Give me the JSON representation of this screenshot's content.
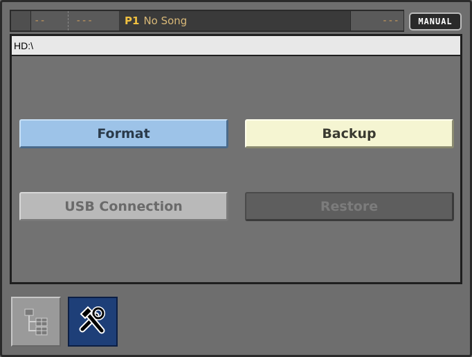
{
  "statusbar": {
    "field1": "--",
    "field2": "---",
    "program": "P1",
    "song": "No Song",
    "field4": "---",
    "mode": "MANUAL"
  },
  "path": "HD:\\",
  "buttons": {
    "format": "Format",
    "backup": "Backup",
    "usb": "USB Connection",
    "restore": "Restore"
  },
  "tabs": {
    "media_icon": "file-tree-icon",
    "utility_icon": "tools-icon"
  },
  "colors": {
    "format_bg": "#9dc3e8",
    "backup_bg": "#f5f5d2",
    "usb_bg": "#b9b9b9",
    "restore_bg": "#5e5e5e",
    "active_tab": "#1e3f78"
  }
}
